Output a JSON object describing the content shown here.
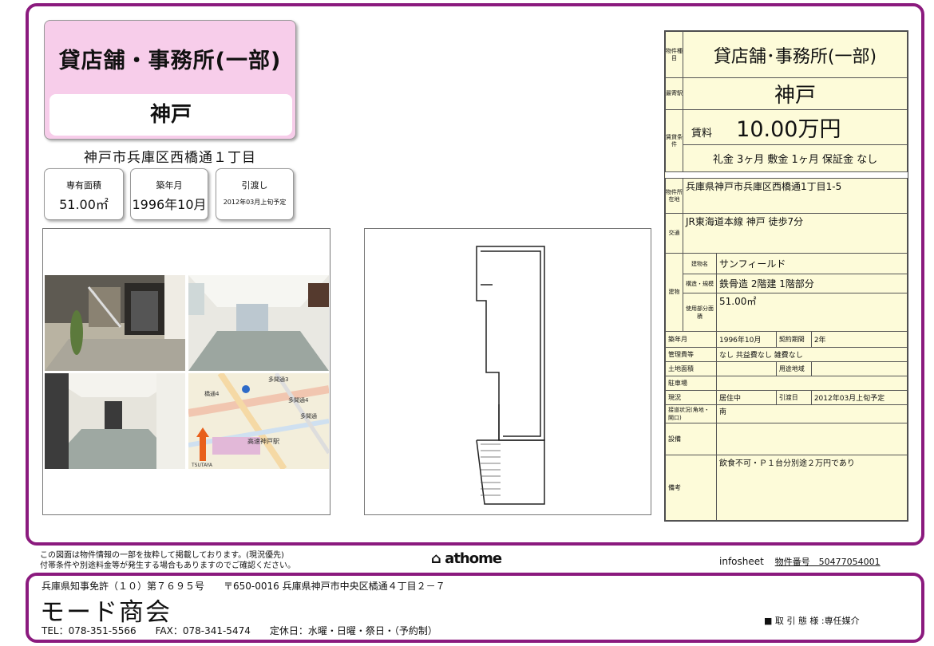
{
  "type": "貸店舗・事務所(一部)",
  "station": "神戸",
  "address_short": "神戸市兵庫区西橋通１丁目",
  "tags": [
    {
      "label": "専有面積",
      "value": "51.00㎡"
    },
    {
      "label": "築年月",
      "value": "1996年10月"
    },
    {
      "label": "引渡し",
      "value": "2012年03月上旬予定"
    }
  ],
  "spec": {
    "type_label": "物件種目",
    "type_value": "貸店舗･事務所(一部)",
    "station_label": "最寄駅",
    "station_value": "神戸",
    "rent_label": "賃貸条件",
    "rent_key": "賃料",
    "rent_value": "10.00万円",
    "rent_terms": "礼金 3ヶ月  敷金 1ヶ月  保証金 なし",
    "location_label": "物件所在地",
    "location_value": "兵庫県神戸市兵庫区西橋通1丁目1-5",
    "access_label": "交通",
    "access_value": "JR東海道本線 神戸 徒歩7分",
    "building_label": "建物",
    "building_name_label": "建物名",
    "building_name": "サンフィールド",
    "structure_label": "構造・規模",
    "structure_value": "鉄骨造 2階建 1階部分",
    "area_label": "使用部分面積",
    "area_value": "51.00㎡",
    "built_label": "築年月",
    "built_value": "1996年10月",
    "contract_label": "契約期間",
    "contract_value": "2年",
    "mgmt_label": "管理費等",
    "mgmt_value": "なし 共益費なし 雑費なし",
    "land_label": "土地面積",
    "zoning_label": "用途地域",
    "parking_label": "駐車場",
    "status_label": "現況",
    "status_value": "居住中",
    "handover_label": "引渡日",
    "handover_value": "2012年03月上旬予定",
    "road_label": "接道状況(角地・開口)",
    "road_value": "南",
    "facility_label": "設備",
    "remarks_label": "備考",
    "remarks_value": "飲食不可・Ｐ１台分別途２万円であり"
  },
  "map": {
    "labels": [
      "多聞通3",
      "多聞通4",
      "橋通4",
      "多聞通",
      "高速神戸駅",
      "TSUTAYA"
    ]
  },
  "footer": {
    "notice1": "この図面は物件情報の一部を抜粋して掲載しております。(現況優先)",
    "notice2": "付帯条件や別途料金等が発生する場合もありますのでご確認ください。",
    "logo": "athome",
    "infosheet": "infosheet",
    "property_no": "物件番号　50477054001"
  },
  "company": {
    "license": "兵庫県知事免許（１０）第７６９５号　　〒650-0016 兵庫県神戸市中央区橘通４丁目２－７",
    "name": "モード商会",
    "contact": "TEL：078-351-5566　　FAX：078-341-5474　　定休日：水曜・日曜・祭日・（予約制）",
    "deal": "■ 取 引 態 様 :専任媒介"
  }
}
